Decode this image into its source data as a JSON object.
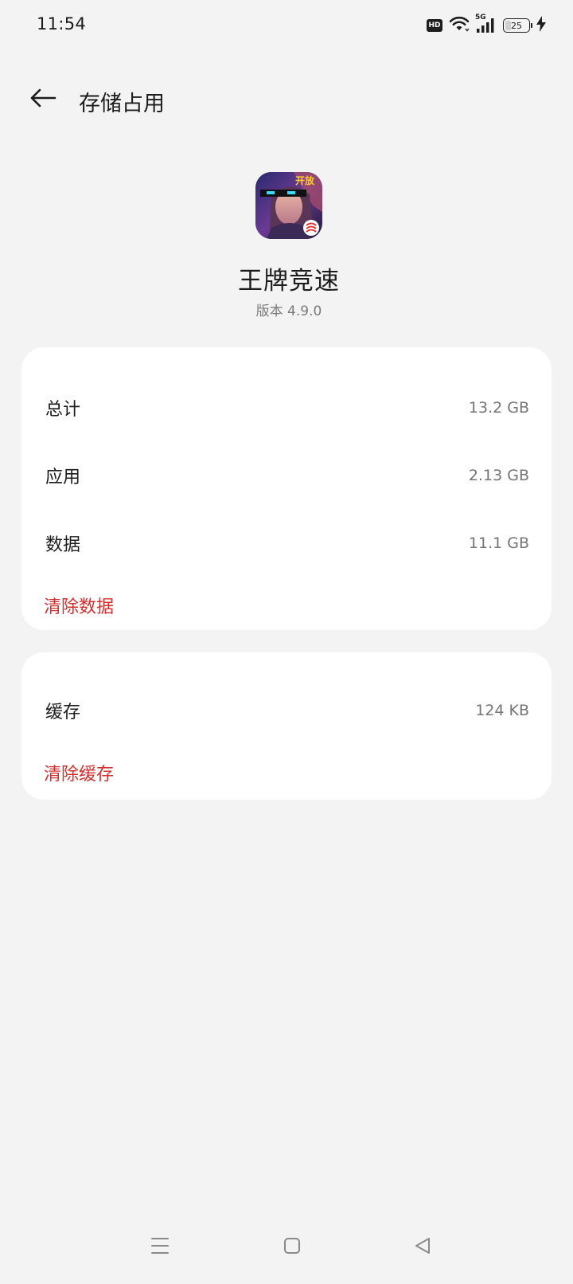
{
  "status_bar": {
    "time": "11:54",
    "hd_label": "HD",
    "network_label": "5G",
    "battery_level": "25",
    "battery_fraction": 0.25
  },
  "header": {
    "title": "存储占用",
    "back_icon": "arrow-left-icon"
  },
  "app": {
    "name": "王牌竞速",
    "version": "版本 4.9.0",
    "icon": "app-icon"
  },
  "storage_card": {
    "rows": [
      {
        "label": "总计",
        "value": "13.2 GB"
      },
      {
        "label": "应用",
        "value": "2.13 GB"
      },
      {
        "label": "数据",
        "value": "11.1 GB"
      }
    ],
    "action": "清除数据"
  },
  "cache_card": {
    "rows": [
      {
        "label": "缓存",
        "value": "124 KB"
      }
    ],
    "action": "清除缓存"
  },
  "nav_bar": {
    "menu_icon": "menu-icon",
    "home_icon": "home-icon",
    "back_icon": "back-triangle-icon"
  },
  "colors": {
    "background": "#f3f3f3",
    "card": "#ffffff",
    "accent_red": "#d2302f",
    "secondary_text": "#757575"
  }
}
